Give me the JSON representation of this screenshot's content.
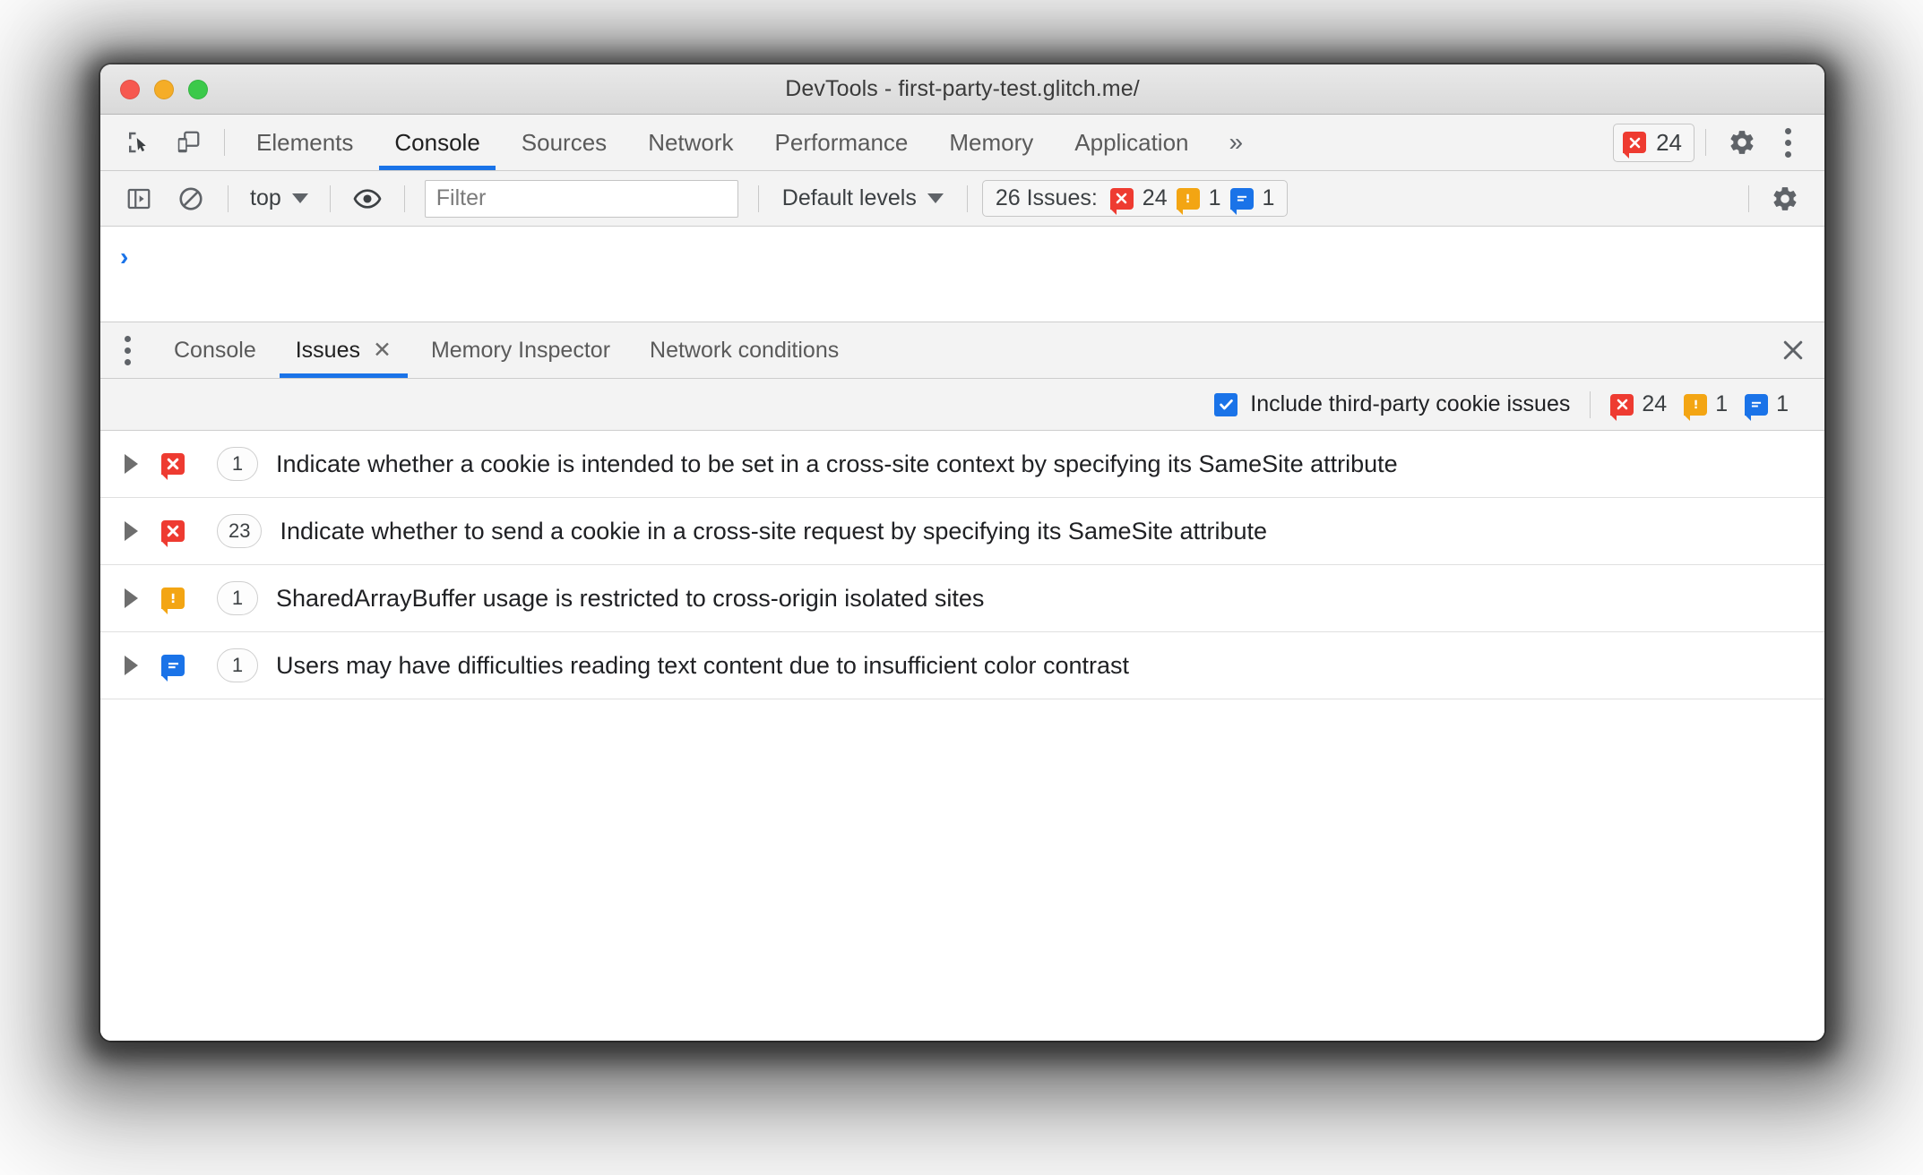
{
  "window": {
    "title": "DevTools - first-party-test.glitch.me/",
    "traffic_lights": [
      "close",
      "minimize",
      "zoom"
    ]
  },
  "main_tabs": {
    "inspect_icon": "inspect-element-icon",
    "device_icon": "device-toolbar-icon",
    "items": [
      {
        "label": "Elements",
        "active": false
      },
      {
        "label": "Console",
        "active": true
      },
      {
        "label": "Sources",
        "active": false
      },
      {
        "label": "Network",
        "active": false
      },
      {
        "label": "Performance",
        "active": false
      },
      {
        "label": "Memory",
        "active": false
      },
      {
        "label": "Application",
        "active": false
      }
    ],
    "overflow_label": "»",
    "error_badge": {
      "icon": "error-bubble-icon",
      "count": "24"
    },
    "settings_icon": "gear-icon",
    "more_icon": "kebab-menu-icon"
  },
  "console_toolbar": {
    "sidebar_toggle_icon": "console-sidebar-icon",
    "clear_icon": "clear-console-icon",
    "context_label": "top",
    "eye_icon": "live-expression-icon",
    "filter_placeholder": "Filter",
    "filter_value": "",
    "levels_label": "Default levels",
    "issues_label": "26 Issues:",
    "issues_counts": [
      {
        "type": "error",
        "count": "24",
        "color": "#ee3b31"
      },
      {
        "type": "warning",
        "count": "1",
        "color": "#f3a513"
      },
      {
        "type": "info",
        "count": "1",
        "color": "#1a73e8"
      }
    ],
    "settings_icon": "gear-icon"
  },
  "console_body": {
    "prompt": "›"
  },
  "drawer": {
    "more_icon": "kebab-menu-icon",
    "tabs": [
      {
        "label": "Console",
        "active": false,
        "closeable": false
      },
      {
        "label": "Issues",
        "active": true,
        "closeable": true,
        "close_label": "✕"
      },
      {
        "label": "Memory Inspector",
        "active": false,
        "closeable": false
      },
      {
        "label": "Network conditions",
        "active": false,
        "closeable": false
      }
    ],
    "close_icon": "close-icon",
    "close_label": "✕"
  },
  "issues_toolbar": {
    "checkbox_checked": true,
    "checkbox_label": "Include third-party cookie issues",
    "counts": [
      {
        "type": "error",
        "count": "24",
        "color": "#ee3b31"
      },
      {
        "type": "warning",
        "count": "1",
        "color": "#f3a513"
      },
      {
        "type": "info",
        "count": "1",
        "color": "#1a73e8"
      }
    ]
  },
  "issues": [
    {
      "severity": "error",
      "count": "1",
      "title": "Indicate whether a cookie is intended to be set in a cross-site context by specifying its SameSite attribute",
      "expanded": false
    },
    {
      "severity": "error",
      "count": "23",
      "title": "Indicate whether to send a cookie in a cross-site request by specifying its SameSite attribute",
      "expanded": false
    },
    {
      "severity": "warning",
      "count": "1",
      "title": "SharedArrayBuffer usage is restricted to cross-origin isolated sites",
      "expanded": false
    },
    {
      "severity": "info",
      "count": "1",
      "title": "Users may have difficulties reading text content due to insufficient color contrast",
      "expanded": false
    }
  ],
  "colors": {
    "error": "#ee3b31",
    "warning": "#f3a513",
    "info": "#1a73e8",
    "accent": "#1a73e8",
    "toolbar_bg": "#f3f3f3"
  }
}
